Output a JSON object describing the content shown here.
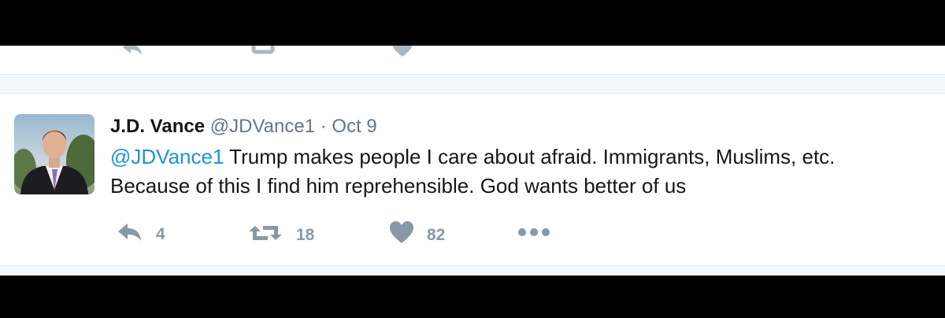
{
  "tweet": {
    "display_name": "J.D. Vance",
    "handle": "@JDVance1",
    "separator": "·",
    "date": "Oct 9",
    "mention": "@JDVance1",
    "line1_rest": " Trump makes people I care about afraid. Immigrants, Muslims, etc.",
    "line2": "Because of this I find him reprehensible. God wants better of us"
  },
  "actions": {
    "reply_count": "4",
    "retweet_count": "18",
    "like_count": "82"
  },
  "colors": {
    "link": "#1b95e0",
    "muted": "#8899a6",
    "text": "#14171a"
  },
  "icons": [
    "reply-icon",
    "retweet-icon",
    "heart-icon",
    "more-icon"
  ]
}
